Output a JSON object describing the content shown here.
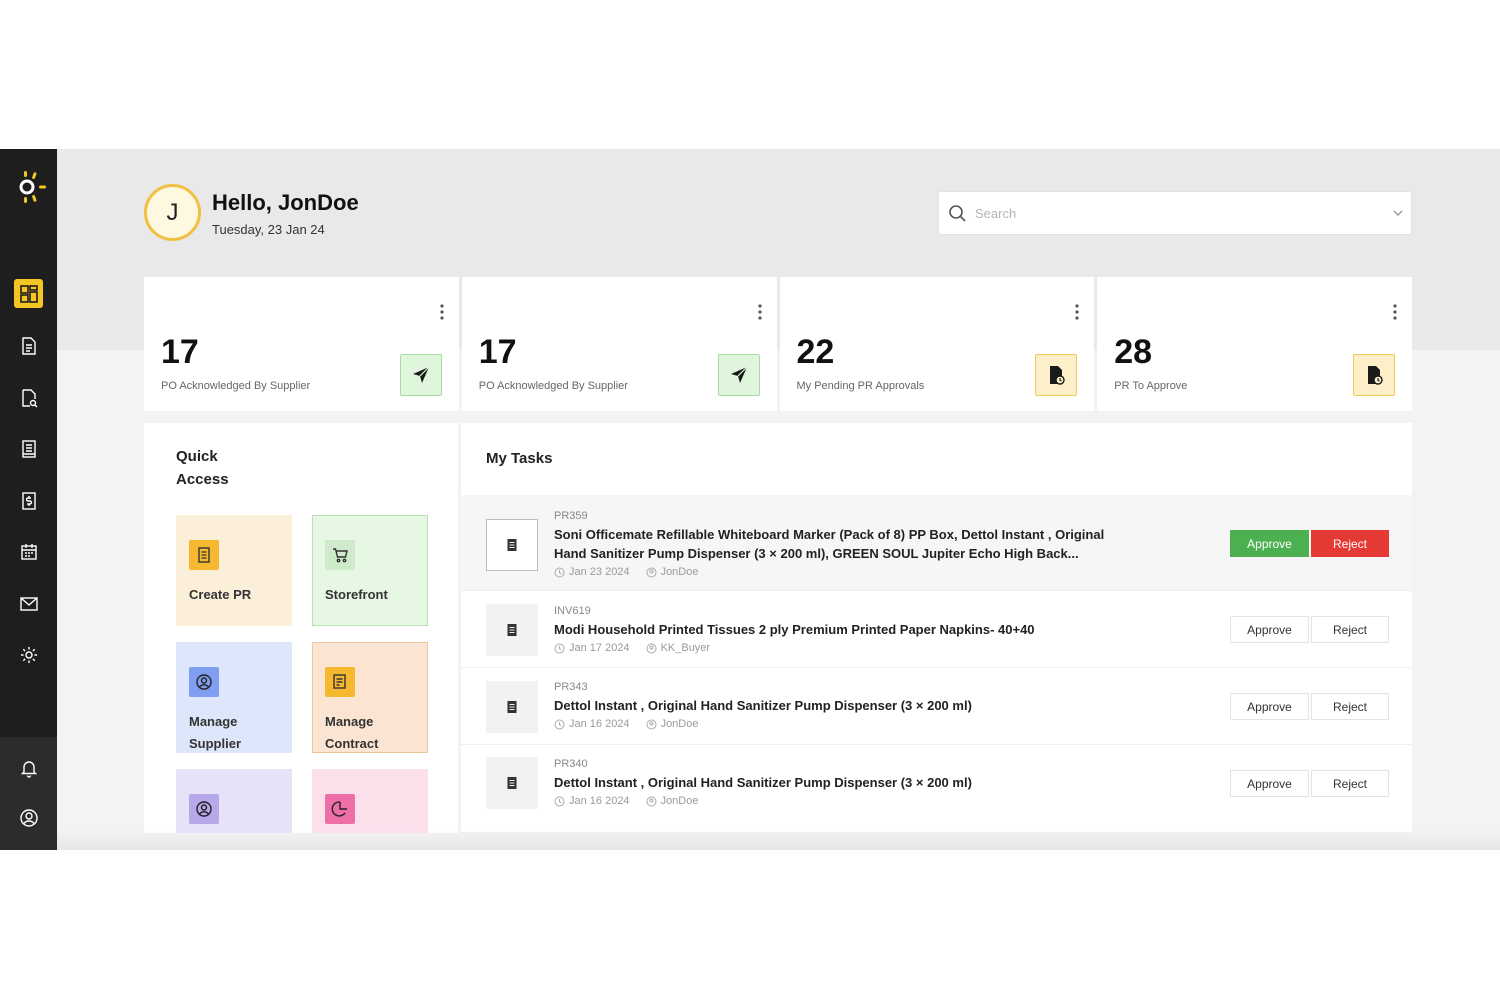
{
  "user": {
    "initial": "J",
    "greeting": "Hello, JonDoe",
    "date": "Tuesday, 23 Jan 24"
  },
  "search": {
    "placeholder": "Search"
  },
  "colors": {
    "sidebar": "#1e1e1e",
    "accent": "#f5c623",
    "approve": "#4caf50",
    "reject": "#e53935"
  },
  "sidebar": {
    "items": [
      {
        "icon": "dashboard-icon",
        "active": true
      },
      {
        "icon": "document-icon"
      },
      {
        "icon": "document-search-icon"
      },
      {
        "icon": "receipt-icon"
      },
      {
        "icon": "invoice-dollar-icon"
      },
      {
        "icon": "calendar-icon"
      },
      {
        "icon": "mail-icon"
      },
      {
        "icon": "settings-icon"
      }
    ],
    "bottom": [
      {
        "icon": "bell-icon"
      },
      {
        "icon": "user-circle-icon"
      }
    ]
  },
  "stats": [
    {
      "value": "17",
      "label": "PO Acknowledged By Supplier",
      "icon": "send-icon"
    },
    {
      "value": "17",
      "label": "PO Acknowledged By Supplier",
      "icon": "send-icon"
    },
    {
      "value": "22",
      "label": "My Pending PR Approvals",
      "icon": "file-clock-icon"
    },
    {
      "value": "28",
      "label": "PR To Approve",
      "icon": "file-clock-icon"
    }
  ],
  "quick_access": {
    "title": "Quick Access",
    "tiles": [
      {
        "label": "Create PR",
        "icon": "document-icon"
      },
      {
        "label": "Storefront",
        "icon": "cart-icon"
      },
      {
        "label": "Manage Supplier",
        "icon": "user-circle-icon"
      },
      {
        "label": "Manage Contract",
        "icon": "contract-icon"
      },
      {
        "label": "",
        "icon": "user-circle-icon"
      },
      {
        "label": "",
        "icon": "pie-chart-icon"
      }
    ]
  },
  "tasks": {
    "title": "My Tasks",
    "approve_label": "Approve",
    "reject_label": "Reject",
    "items": [
      {
        "id": "PR359",
        "title": "Soni Officemate Refillable Whiteboard Marker (Pack of 8) PP Box, Dettol Instant , Original Hand Sanitizer Pump Dispenser (3 × 200 ml), GREEN SOUL Jupiter Echo High Back...",
        "date": "Jan 23 2024",
        "user": "JonDoe"
      },
      {
        "id": "INV619",
        "title": "Modi Household Printed Tissues 2 ply Premium Printed Paper Napkins- 40+40",
        "date": "Jan 17 2024",
        "user": "KK_Buyer"
      },
      {
        "id": "PR343",
        "title": "Dettol Instant , Original Hand Sanitizer Pump Dispenser (3 × 200 ml)",
        "date": "Jan 16 2024",
        "user": "JonDoe"
      },
      {
        "id": "PR340",
        "title": "Dettol Instant , Original Hand Sanitizer Pump Dispenser (3 × 200 ml)",
        "date": "Jan 16 2024",
        "user": "JonDoe"
      }
    ]
  }
}
